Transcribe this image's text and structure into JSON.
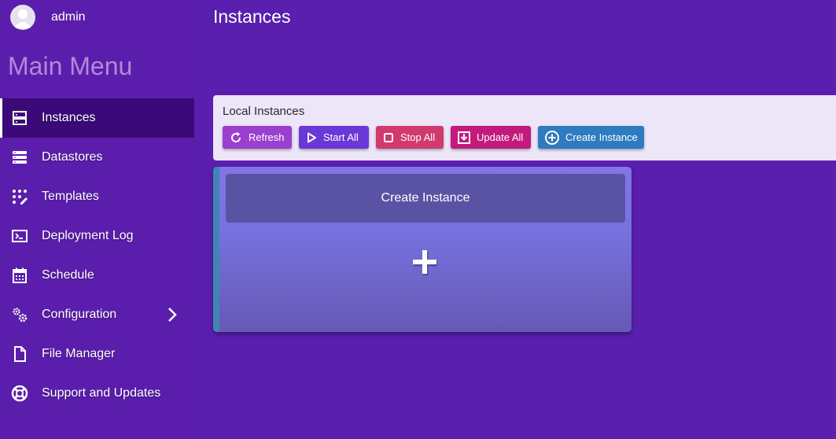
{
  "user": {
    "name": "admin"
  },
  "sidebar": {
    "title": "Main Menu",
    "items": [
      {
        "label": "Instances",
        "icon": "server-icon",
        "active": true
      },
      {
        "label": "Datastores",
        "icon": "datastore-icon"
      },
      {
        "label": "Templates",
        "icon": "templates-icon"
      },
      {
        "label": "Deployment Log",
        "icon": "terminal-icon"
      },
      {
        "label": "Schedule",
        "icon": "calendar-icon"
      },
      {
        "label": "Configuration",
        "icon": "gears-icon",
        "has_submenu": true
      },
      {
        "label": "File Manager",
        "icon": "file-icon"
      },
      {
        "label": "Support and Updates",
        "icon": "lifebuoy-icon"
      }
    ]
  },
  "page": {
    "title": "Instances"
  },
  "panel": {
    "title": "Local Instances",
    "buttons": {
      "refresh": "Refresh",
      "start_all": "Start All",
      "stop_all": "Stop All",
      "update_all": "Update All",
      "create_instance": "Create Instance"
    }
  },
  "card": {
    "title": "Create Instance",
    "icon": "plus-icon"
  },
  "colors": {
    "background": "#5a1fae",
    "active_item": "#3c0a78",
    "panel": "#ede5f8",
    "refresh": "#9a3fcf",
    "start_all": "#6a38d6",
    "stop_all": "#d13a6c",
    "update_all": "#c21a7d",
    "create_instance": "#2e7bbf",
    "card": "#7671de"
  }
}
